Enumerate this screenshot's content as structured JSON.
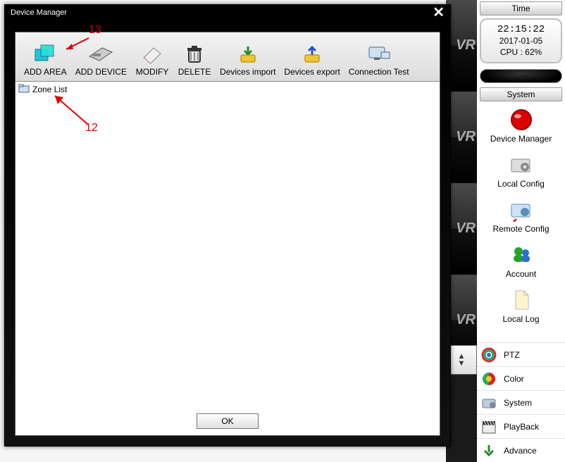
{
  "dialog": {
    "title": "Device Manager",
    "toolbar": {
      "add_area": "ADD AREA",
      "add_device": "ADD DEVICE",
      "modify": "MODIFY",
      "delete": "DELETE",
      "dev_import": "Devices import",
      "dev_export": "Devices export",
      "conn_test": "Connection Test"
    },
    "tree_root": "Zone List",
    "ok": "OK"
  },
  "side": {
    "time_header": "Time",
    "clock": "22:15:22",
    "date": "2017-01-05",
    "cpu": "CPU : 62%",
    "system_header": "System",
    "items": {
      "device_manager": "Device Manager",
      "local_config": "Local Config",
      "remote_config": "Remote Config",
      "account": "Account",
      "local_log": "Local Log"
    },
    "tools": {
      "ptz": "PTZ",
      "color": "Color",
      "system": "System",
      "playback": "PlayBack",
      "advance": "Advance"
    }
  },
  "annotations": {
    "a12": "12",
    "a13": "13"
  },
  "wr_text": "VR"
}
